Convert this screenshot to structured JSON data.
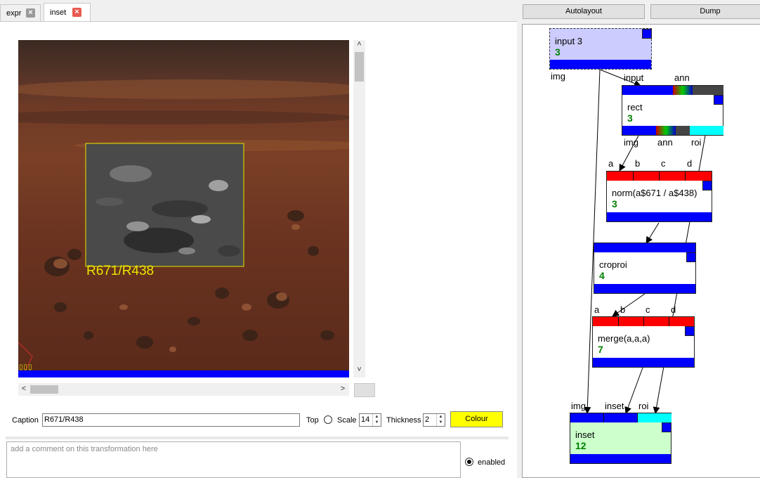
{
  "tabs": [
    {
      "label": "expr",
      "active": false
    },
    {
      "label": "inset",
      "active": true
    }
  ],
  "image_viewer": {
    "overlay_caption": "R671/R438",
    "corner_marks": "▯▯▯"
  },
  "scroll": {
    "up": "˄",
    "down": "˅",
    "left": "<",
    "right": ">"
  },
  "controls": {
    "caption_label": "Caption",
    "caption_value": "R671/R438",
    "top_label": "Top",
    "scale_label": "Scale",
    "scale_value": "14",
    "thickness_label": "Thickness",
    "thickness_value": "2",
    "colour_button": "Colour"
  },
  "comment": {
    "placeholder": "add a comment on this transformation here",
    "enabled_label": "enabled"
  },
  "graph_toolbar": {
    "autolayout": "Autolayout",
    "dump": "Dump"
  },
  "graph": {
    "nodes": [
      {
        "id": "input3",
        "label": "input 3",
        "num": "3",
        "outputs": [
          "img"
        ]
      },
      {
        "id": "rect",
        "label": "rect",
        "num": "3",
        "inputs": [
          "input",
          "ann"
        ],
        "outputs": [
          "img",
          "ann",
          "roi"
        ]
      },
      {
        "id": "norm",
        "label": "norm(a$671 / a$438)",
        "num": "3",
        "inputs": [
          "a",
          "b",
          "c",
          "d"
        ]
      },
      {
        "id": "croproi",
        "label": "croproi",
        "num": "4"
      },
      {
        "id": "merge",
        "label": "merge(a,a,a)",
        "num": "7",
        "inputs": [
          "a",
          "b",
          "c",
          "d"
        ]
      },
      {
        "id": "inset",
        "label": "inset",
        "num": "12",
        "inputs": [
          "img",
          "inset",
          "roi"
        ]
      }
    ]
  },
  "colors": {
    "port_blue": "#0000ff",
    "port_red": "#ff0000",
    "port_cyan": "#00ffff",
    "input_node_bg": "#ccccff",
    "inset_node_bg": "#ccffcc",
    "number_green": "#008000",
    "caption_yellow": "#ffff00"
  }
}
